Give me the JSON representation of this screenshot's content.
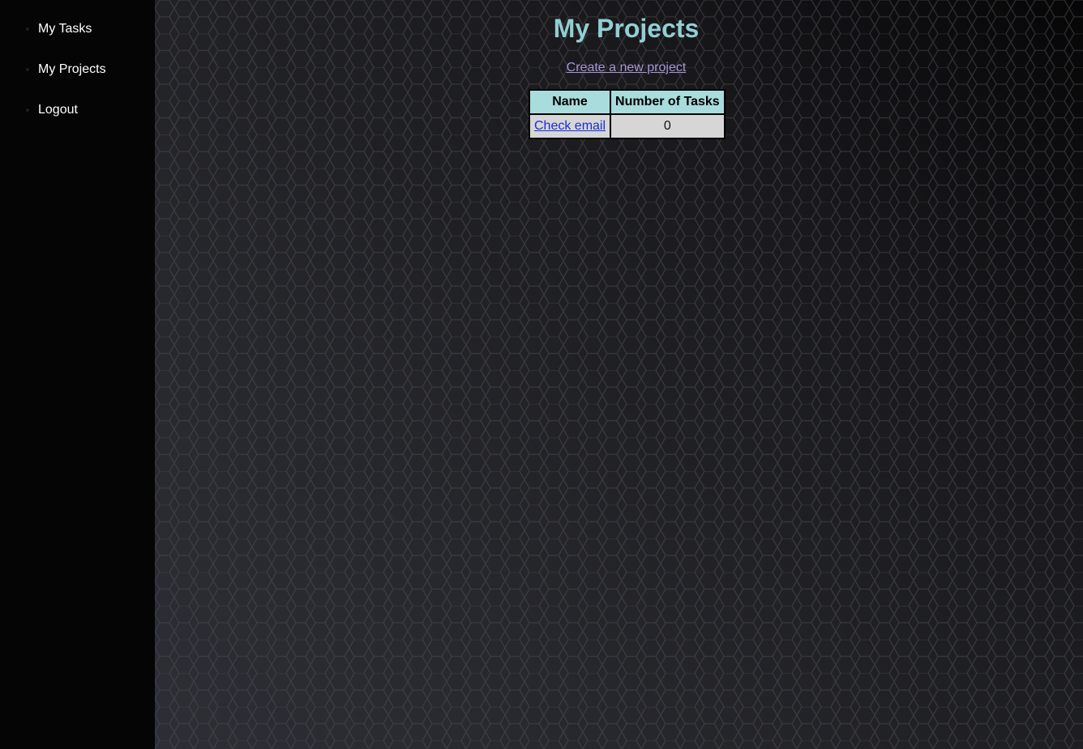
{
  "sidebar": {
    "items": [
      {
        "label": "My Tasks"
      },
      {
        "label": "My Projects"
      },
      {
        "label": "Logout"
      }
    ]
  },
  "main": {
    "title": "My Projects",
    "create_link": "Create a new project",
    "table": {
      "headers": [
        "Name",
        "Number of Tasks"
      ],
      "rows": [
        {
          "name": "Check email",
          "tasks": "0"
        }
      ]
    }
  },
  "colors": {
    "title": "#92ced3",
    "link": "#a796d6",
    "header_bg": "#a9dcdc",
    "cell_bg": "#d6d6d6",
    "sidebar_bg": "#050505"
  }
}
